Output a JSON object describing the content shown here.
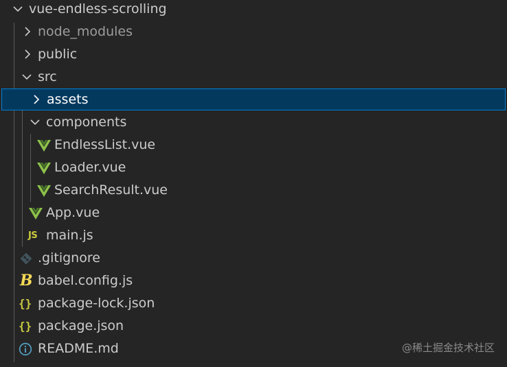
{
  "explorer": {
    "root_label": "vue-endless-scrolling",
    "items": [
      {
        "label": "node_modules",
        "kind": "folder",
        "state": "collapsed",
        "ignored": true
      },
      {
        "label": "public",
        "kind": "folder",
        "state": "collapsed"
      },
      {
        "label": "src",
        "kind": "folder",
        "state": "expanded"
      },
      {
        "label": "assets",
        "kind": "folder",
        "state": "collapsed",
        "selected": true
      },
      {
        "label": "components",
        "kind": "folder",
        "state": "expanded"
      },
      {
        "label": "EndlessList.vue",
        "kind": "file",
        "icon": "vue-icon"
      },
      {
        "label": "Loader.vue",
        "kind": "file",
        "icon": "vue-icon"
      },
      {
        "label": "SearchResult.vue",
        "kind": "file",
        "icon": "vue-icon"
      },
      {
        "label": "App.vue",
        "kind": "file",
        "icon": "vue-icon"
      },
      {
        "label": "main.js",
        "kind": "file",
        "icon": "js-icon",
        "icon_text": "JS"
      },
      {
        "label": ".gitignore",
        "kind": "file",
        "icon": "git-icon"
      },
      {
        "label": "babel.config.js",
        "kind": "file",
        "icon": "babel-icon",
        "icon_text": "B"
      },
      {
        "label": "package-lock.json",
        "kind": "file",
        "icon": "json-icon",
        "icon_text": "{}"
      },
      {
        "label": "package.json",
        "kind": "file",
        "icon": "json-icon",
        "icon_text": "{}"
      },
      {
        "label": "README.md",
        "kind": "file",
        "icon": "info-icon"
      }
    ]
  },
  "watermark": "@稀土掘金技术社区",
  "colors": {
    "background": "#252526",
    "selection": "#04395e",
    "selection_border": "#007fd4",
    "vue_green": "#8dc149",
    "json_yellow": "#cbcb41",
    "info_blue": "#519aba"
  }
}
